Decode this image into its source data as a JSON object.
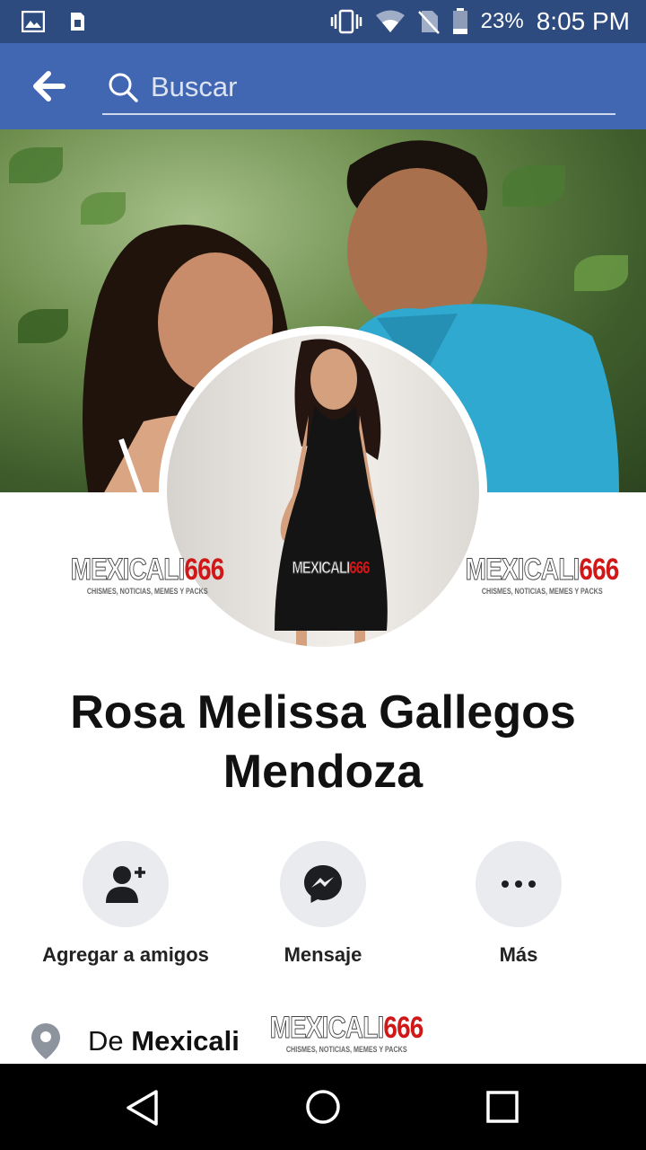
{
  "status_bar": {
    "battery": "23%",
    "time": "8:05 PM",
    "icons": [
      "image-icon",
      "download-icon",
      "vibrate-icon",
      "wifi-icon",
      "no-sim-icon",
      "battery-icon"
    ]
  },
  "app_bar": {
    "search_placeholder": "Buscar",
    "back_icon": "arrow-left-icon"
  },
  "watermark": {
    "brand_part1": "MEXICALI",
    "brand_part2": "666",
    "tagline": "CHISMES, NOTICIAS, MEMES Y PACKS"
  },
  "profile": {
    "name_line1": "Rosa Melissa Gallegos",
    "name_line2": "Mendoza"
  },
  "actions": [
    {
      "label": "Agregar a amigos",
      "icon": "add-friend-icon"
    },
    {
      "label": "Mensaje",
      "icon": "messenger-icon"
    },
    {
      "label": "Más",
      "icon": "more-icon"
    }
  ],
  "info": {
    "prefix": "De",
    "location": "Mexicali",
    "icon": "location-pin-icon"
  },
  "nav": [
    "back-triangle-icon",
    "home-circle-icon",
    "recents-square-icon"
  ],
  "colors": {
    "status_bar": "#2e4b80",
    "app_bar": "#4267b2",
    "action_bg": "#e9ebee"
  }
}
